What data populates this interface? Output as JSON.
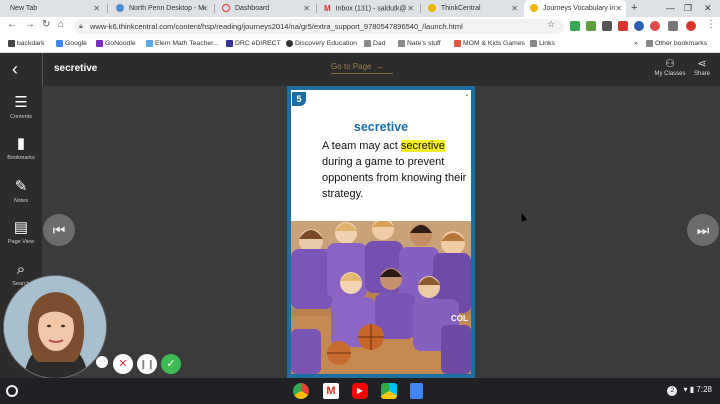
{
  "browser": {
    "tabs": [
      {
        "title": "New Tab",
        "color": "#dee1e6"
      },
      {
        "title": "North Penn Desktop - M",
        "color": "#4a8fd9"
      },
      {
        "title": "Dashboard",
        "color": "#d9342b"
      },
      {
        "title": "Inbox (131) - saldutk@",
        "color": "#d9342b"
      },
      {
        "title": "ThinkCentral",
        "color": "#f2b600"
      },
      {
        "title": "Journeys Vocabulary in",
        "color": "#f2b600"
      }
    ],
    "new_tab_symbol": "+",
    "url": "www-k6.thinkcentral.com/content/hsp/reading/journeys2014/na/gr5/extra_support_9780547896540_/launch.html",
    "bookmarks": [
      {
        "label": "backdark",
        "color": "#444444"
      },
      {
        "label": "Google",
        "color": "#4285f4"
      },
      {
        "label": "GoNoodle",
        "color": "#7b2fbe"
      },
      {
        "label": "Elem Math Teacher...",
        "color": "#5aa9e6"
      },
      {
        "label": "DRC eDIRECT",
        "color": "#333399"
      },
      {
        "label": "Discovery Education",
        "color": "#333333"
      },
      {
        "label": "Dad",
        "color": "#888888"
      },
      {
        "label": "Nate's stuff",
        "color": "#888888"
      },
      {
        "label": "MOM & Kids Games",
        "color": "#e8553b"
      },
      {
        "label": "Links",
        "color": "#888888"
      }
    ],
    "other_bookmarks": "Other bookmarks"
  },
  "app": {
    "title": "secretive",
    "goto_label": "Go to Page",
    "goto_arrow": "→",
    "my_classes": "My Classes",
    "share": "Share",
    "sidebar": [
      {
        "label": "Contents",
        "icon": "☰"
      },
      {
        "label": "Bookmarks",
        "icon": "▮"
      },
      {
        "label": "Notes",
        "icon": "✎"
      },
      {
        "label": "Page View",
        "icon": "▤"
      },
      {
        "label": "Search",
        "icon": "⌕"
      }
    ]
  },
  "card": {
    "number": "5",
    "word": "secretive",
    "sentence_before": "A team may act ",
    "sentence_highlight": "secretive",
    "sentence_after": " during a game to prevent opponents from knowing their strategy.",
    "accent_color": "#1d6ea1",
    "highlight_color": "#f5ef2a"
  },
  "system": {
    "notification_count": "2",
    "time": "7:28"
  }
}
